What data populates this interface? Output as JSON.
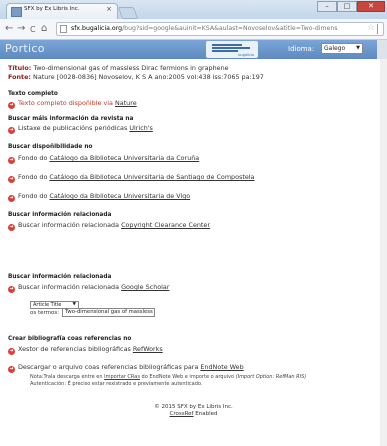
{
  "browser": {
    "tab_title": "SFX by Ex Libris Inc.",
    "tab_close": "×",
    "url_host": "sfx.bugalicia.org",
    "url_rest": "/bug?sid=google&auinit=KSA&aulast=Novoselov&atitle=Two-dimens",
    "window_min": "–",
    "window_max": "□",
    "window_close": "✕",
    "back": "←",
    "forward": "→",
    "reload": "C",
    "home": "⌂"
  },
  "header": {
    "logo": "Portico",
    "lang_label": "Idioma:",
    "lang_value": "Galego",
    "logo_caption": "bugalicia"
  },
  "record": {
    "title_label": "Título:",
    "title_value": "Two-dimensional gas of massless Dirac fermions in graphene",
    "source_label": "Fonte:",
    "source_value": "Nature [0028-0836] Novoselov, K S A ano:2005 vol:438 iss:7065 pa:197"
  },
  "sections": {
    "full_text": {
      "title": "Texto completo",
      "item": "Texto completo dispoñible via ",
      "link": "Nature"
    },
    "journal": {
      "title": "Buscar máis información da revista na",
      "item": "Listaxe de publicacións periódicas ",
      "link": "Ulrich's"
    },
    "availability": {
      "title": "Buscar dispoñibilidade no",
      "items": [
        {
          "prefix": "Fondo do ",
          "link": "Catálogo da Biblioteca Universitaria da Coruña"
        },
        {
          "prefix": "Fondo do ",
          "link": "Catálogo da Biblioteca Universitaria de Santiago de Compostela"
        },
        {
          "prefix": "Fondo do ",
          "link": "Catálogo da Biblioteca Universitaria de Vigo"
        }
      ]
    },
    "related1": {
      "title": "Buscar información relacionada",
      "item": "Buscar información relacionada ",
      "link": "Copyright Clearance Center"
    },
    "related2": {
      "title": "Buscar información relacionada",
      "item": "Buscar información relacionada ",
      "link": "Google Scholar",
      "select_value": "Article Title",
      "terms_label": "os termos:",
      "terms_value": "Two-dimensional gas of massless"
    },
    "bibliography": {
      "title": "Crear bibliografía coas referencias no",
      "item1": "Xestor de referencias bibliográficas ",
      "link1": "RefWorks",
      "item2": "Descargar o arquivo coas referencias bibliográficas para ",
      "link2": "EndNote Web",
      "note1_a": "Nota:Trala descarga entre en ",
      "note1_link": "Importar CRas",
      "note1_b": " do EndNote Web e importe o arquivo ",
      "note1_c": "(Import Option: RefMan RIS)",
      "note2": "Autenticación: É preciso estar rexistrado e previamente autenticado."
    }
  },
  "footer": {
    "copyright": "© 2015 SFX by Ex Libris Inc.",
    "crossref_link": "CrossRef",
    "crossref_text": " Enabled"
  },
  "colors": {
    "header_blue": "#6b97cb",
    "icon_red": "#d8403a",
    "label_red": "#8a1c1c"
  }
}
